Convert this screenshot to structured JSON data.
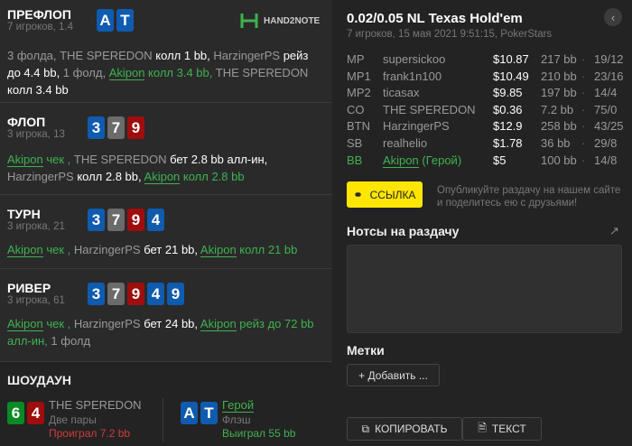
{
  "logo": {
    "text": "HAND2NOTE",
    "accent": "#3fb24f"
  },
  "streets": [
    {
      "title": "ПРЕФЛОП",
      "sub": "7 игроков, 1.4",
      "cards": [
        {
          "r": "A",
          "s": "s"
        },
        {
          "r": "T",
          "s": "s"
        }
      ],
      "actions": [
        {
          "t": "3 фолда, ",
          "c": "name"
        },
        {
          "t": "THE SPEREDON",
          "c": "name"
        },
        {
          "t": " колл 1 bb, ",
          "c": "act"
        },
        {
          "t": "HarzingerPS",
          "c": "name"
        },
        {
          "t": " рейз до 4.4 bb, ",
          "c": "act"
        },
        {
          "t": "1 фолд, ",
          "c": "name"
        },
        {
          "t": "Akipon",
          "c": "hn"
        },
        {
          "t": " колл 3.4 bb, ",
          "c": "hero"
        },
        {
          "t": "THE SPEREDON",
          "c": "name"
        },
        {
          "t": " колл 3.4 bb",
          "c": "act"
        }
      ]
    },
    {
      "title": "ФЛОП",
      "sub": "3 игрока, 13",
      "cards": [
        {
          "r": "3",
          "s": "s"
        },
        {
          "r": "7",
          "s": "x"
        },
        {
          "r": "9",
          "s": "h"
        }
      ],
      "actions": [
        {
          "t": "Akipon",
          "c": "hn"
        },
        {
          "t": " чек , ",
          "c": "hero"
        },
        {
          "t": "THE SPEREDON",
          "c": "name"
        },
        {
          "t": " бет 2.8 bb алл-ин, ",
          "c": "act"
        },
        {
          "t": "HarzingerPS",
          "c": "name"
        },
        {
          "t": " колл 2.8 bb, ",
          "c": "act"
        },
        {
          "t": "Akipon",
          "c": "hn"
        },
        {
          "t": " колл 2.8 bb",
          "c": "hero"
        }
      ]
    },
    {
      "title": "ТУРН",
      "sub": "3 игрока, 21",
      "cards": [
        {
          "r": "3",
          "s": "s"
        },
        {
          "r": "7",
          "s": "x"
        },
        {
          "r": "9",
          "s": "h"
        },
        {
          "r": "4",
          "s": "s"
        }
      ],
      "actions": [
        {
          "t": "Akipon",
          "c": "hn"
        },
        {
          "t": " чек , ",
          "c": "hero"
        },
        {
          "t": "HarzingerPS",
          "c": "name"
        },
        {
          "t": " бет 21 bb, ",
          "c": "act"
        },
        {
          "t": "Akipon",
          "c": "hn"
        },
        {
          "t": " колл 21 bb",
          "c": "hero"
        }
      ]
    },
    {
      "title": "РИВЕР",
      "sub": "3 игрока, 61",
      "cards": [
        {
          "r": "3",
          "s": "s"
        },
        {
          "r": "7",
          "s": "x"
        },
        {
          "r": "9",
          "s": "h"
        },
        {
          "r": "4",
          "s": "s"
        },
        {
          "r": "9",
          "s": "s"
        }
      ],
      "actions": [
        {
          "t": "Akipon",
          "c": "hn"
        },
        {
          "t": " чек , ",
          "c": "hero"
        },
        {
          "t": "HarzingerPS",
          "c": "name"
        },
        {
          "t": " бет 24 bb, ",
          "c": "act"
        },
        {
          "t": "Akipon",
          "c": "hn"
        },
        {
          "t": " рейз до 72 bb алл-ин, ",
          "c": "hero"
        },
        {
          "t": "1 фолд",
          "c": "name"
        }
      ]
    }
  ],
  "showdown": {
    "title": "ШОУДАУН",
    "players": [
      {
        "cards": [
          {
            "r": "6",
            "s": "c"
          },
          {
            "r": "4",
            "s": "h"
          }
        ],
        "name": "THE SPEREDON",
        "hand": "Две пары",
        "result": "Проиграл 7.2 bb",
        "result_color": "#d23a3a"
      },
      {
        "cards": [
          {
            "r": "A",
            "s": "s"
          },
          {
            "r": "T",
            "s": "s"
          }
        ],
        "name": "Герой",
        "hand": "Флэш",
        "result": "Выиграл 55 bb",
        "result_color": "#3fb24f"
      }
    ]
  },
  "header": {
    "title": "0.02/0.05 NL Texas Hold'em",
    "sub": "7 игроков, 15 мая 2021 9:51:15, PokerStars",
    "back_icon": "chevron-left-icon"
  },
  "players": [
    {
      "pos": "MP",
      "name": "supersickoo",
      "stack": "$10.87",
      "bb": "217 bb",
      "vpip": "19/12"
    },
    {
      "pos": "MP1",
      "name": "frank1n100",
      "stack": "$10.49",
      "bb": "210 bb",
      "vpip": "23/16"
    },
    {
      "pos": "MP2",
      "name": "ticasax",
      "stack": "$9.85",
      "bb": "197 bb",
      "vpip": "14/4"
    },
    {
      "pos": "CO",
      "name": "THE SPEREDON",
      "stack": "$0.36",
      "bb": "7.2 bb",
      "vpip": "75/0"
    },
    {
      "pos": "BTN",
      "name": "HarzingerPS",
      "stack": "$12.9",
      "bb": "258 bb",
      "vpip": "43/25"
    },
    {
      "pos": "SB",
      "name": "realhelio",
      "stack": "$1.78",
      "bb": "36 bb",
      "vpip": "29/8"
    },
    {
      "pos": "BB",
      "name": "Akipon",
      "hero_tag": " (Герой)",
      "stack": "$5",
      "bb": "100 bb",
      "vpip": "14/8",
      "hero": true
    }
  ],
  "dot": "·",
  "link": {
    "label": "ССЫЛКА",
    "hint": "Опубликуйте раздачу на нашем сайте и поделитесь ею с друзьями!",
    "color": "#ffe600"
  },
  "notes": {
    "title": "Нотсы на раздачу",
    "value": ""
  },
  "tags": {
    "title": "Метки",
    "add": "+ Добавить ..."
  },
  "footer": {
    "copy": "КОПИРОВАТЬ",
    "text": "ТЕКСТ"
  }
}
